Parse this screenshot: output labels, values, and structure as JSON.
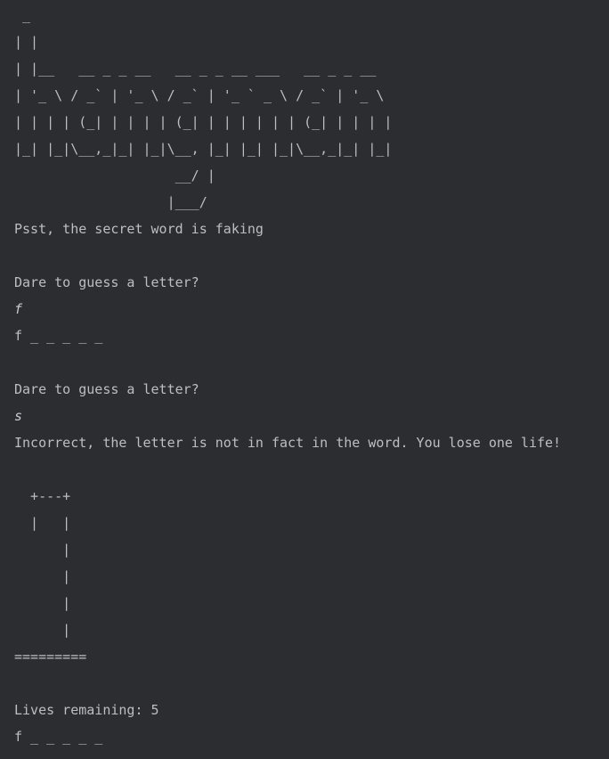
{
  "console": {
    "banner": [
      " _",
      "| |",
      "| |__   __ _ _ __   __ _ _ __ ___   __ _ _ __",
      "| '_ \\ / _` | '_ \\ / _` | '_ ` _ \\ / _` | '_ \\",
      "| | | | (_| | | | | (_| | | | | | | (_| | | | |",
      "|_| |_|\\__,_|_| |_|\\__, |_| |_| |_|\\__,_|_| |_|",
      "                    __/ |",
      "                   |___/"
    ],
    "secret_msg": "Psst, the secret word is faking",
    "prompt1": "Dare to guess a letter?",
    "input1": "f",
    "progress1": "f _ _ _ _ _",
    "prompt2": "Dare to guess a letter?",
    "input2": "s",
    "incorrect_msg": "Incorrect, the letter is not in fact in the word. You lose one life!",
    "gallows": [
      "  +---+",
      "  |   |",
      "      |",
      "      |",
      "      |",
      "      |",
      "========="
    ],
    "lives_text": "Lives remaining: 5",
    "progress2": "f _ _ _ _ _"
  }
}
